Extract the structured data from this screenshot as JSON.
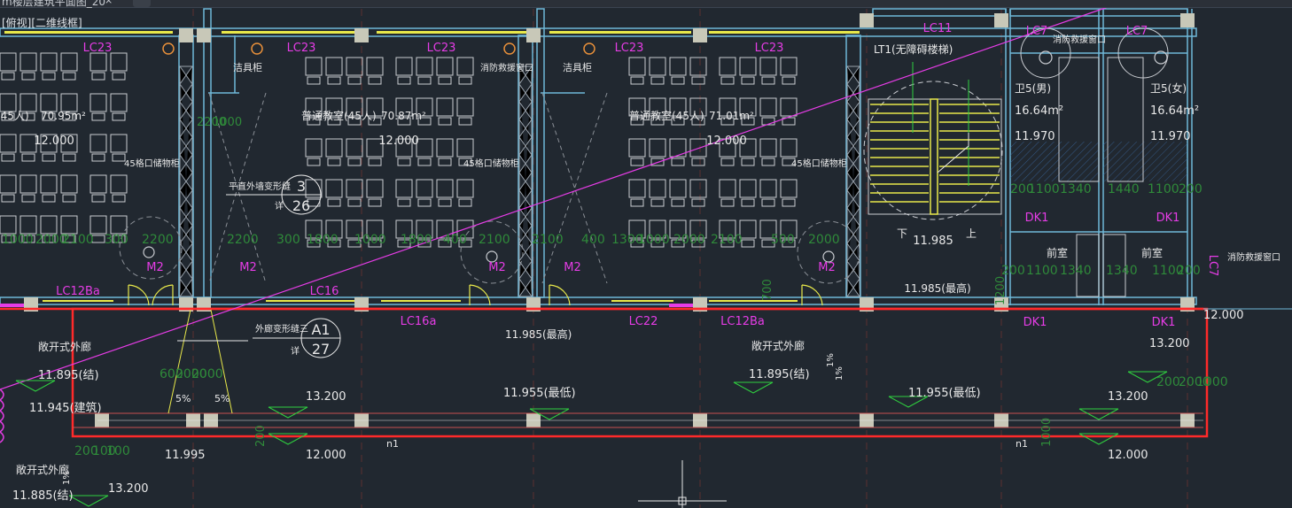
{
  "window": {
    "tab_title": "m楼层建筑平面图_20",
    "close_icon": "close-icon",
    "add_tab_icon": "plus-icon",
    "viewport_label": "[俯视][二维线框]"
  },
  "colors": {
    "background": "#212830",
    "wall": "#6fb8d8",
    "magenta": "#e63ce6",
    "red_selection": "#ff2a2a",
    "yellow": "#e8e84a",
    "green": "#2fcf3f",
    "dim_green": "#2f8a3a",
    "white_text": "#e8e8e8",
    "column": "#c8c8b8"
  },
  "drawing": {
    "window_labels": [
      "LC23",
      "LC23",
      "LC23",
      "LC23",
      "LC23",
      "LC11",
      "LC7",
      "LC7",
      "LC12Ba",
      "LC16",
      "LC16a",
      "LC22",
      "LC12Ba",
      "LC7",
      "DK1",
      "DK1",
      "DK1",
      "DK1"
    ],
    "door_labels": [
      "M2",
      "M2",
      "M2",
      "M2",
      "M2"
    ],
    "rooms": [
      {
        "name": "(45人)",
        "area": "70.95m²",
        "elev": "12.000"
      },
      {
        "name": "普通教室(45人)",
        "area": "70.87m²",
        "elev": "12.000"
      },
      {
        "name": "普通教室(45人)",
        "area": "71.01m²",
        "elev": "12.000"
      }
    ],
    "toilets": [
      {
        "name": "卫5(男)",
        "area": "16.64m²",
        "elev": "11.970"
      },
      {
        "name": "卫5(女)",
        "area": "16.64m²",
        "elev": "11.970"
      }
    ],
    "stair_title": "LT1(无障碍楼梯)",
    "stair_elev": "11.985",
    "stair_elev_top": "11.985(最高)",
    "stair_down": "下",
    "stair_up": "上",
    "anteroom": [
      "前室",
      "前室"
    ],
    "mop_labels": [
      "洁具柜",
      "洁具柜"
    ],
    "fire_window": [
      "消防救援窗口",
      "消防救援窗口",
      "消防救援窗口"
    ],
    "cabinet_labels": [
      "45格口储物柜",
      "45格口储物柜",
      "45格口储物柜"
    ],
    "detail_refs": [
      {
        "note": "平直外墙变形缝",
        "num": "3",
        "sheet": "26",
        "xiang": "详"
      },
      {
        "note": "外廊变形缝三",
        "num": "A1",
        "sheet": "27",
        "xiang": "详"
      }
    ],
    "corridor": {
      "name": "敞开式外廊",
      "elev_a": "11.895(结)",
      "elev_b": "11.945(建筑)",
      "elev_c": "11.885(结)",
      "elev_mid": "11.895(结)",
      "elev_top": "11.985(最高)"
    },
    "corridor_name_left": "敞开式外廊",
    "corridor_name_lower": "敞开式外廊",
    "levels": [
      "13.200",
      "13.200",
      "13.200",
      "13.200",
      "11.955(最低)",
      "11.955(最低)",
      "12.000",
      "12.000",
      "12.000",
      "11.995"
    ],
    "slopes": [
      "5%",
      "5%",
      "1%",
      "1%",
      "1%"
    ],
    "pipe_labels": [
      "n1",
      "n1"
    ],
    "dims_top": [
      "2200",
      "1000",
      "2000",
      "100",
      "1000"
    ],
    "dims_row": [
      "1000",
      "2000",
      "2100",
      "300",
      "2200",
      "2200",
      "300",
      "1800",
      "1000",
      "1800",
      "400",
      "2100",
      "2100",
      "400",
      "1300",
      "1000",
      "2000",
      "2100",
      "500",
      "2000"
    ],
    "dims_toilet": [
      "200",
      "1100",
      "1340",
      "1440",
      "1100",
      "200",
      "200",
      "1100",
      "1340",
      "1340",
      "1100",
      "200"
    ],
    "dims_misc": [
      "600",
      "2000",
      "2000",
      "200",
      "100",
      "100",
      "200",
      "2000",
      "1000",
      "200",
      "1000",
      "1200",
      "700",
      "100",
      "1200",
      "200",
      "100"
    ]
  }
}
